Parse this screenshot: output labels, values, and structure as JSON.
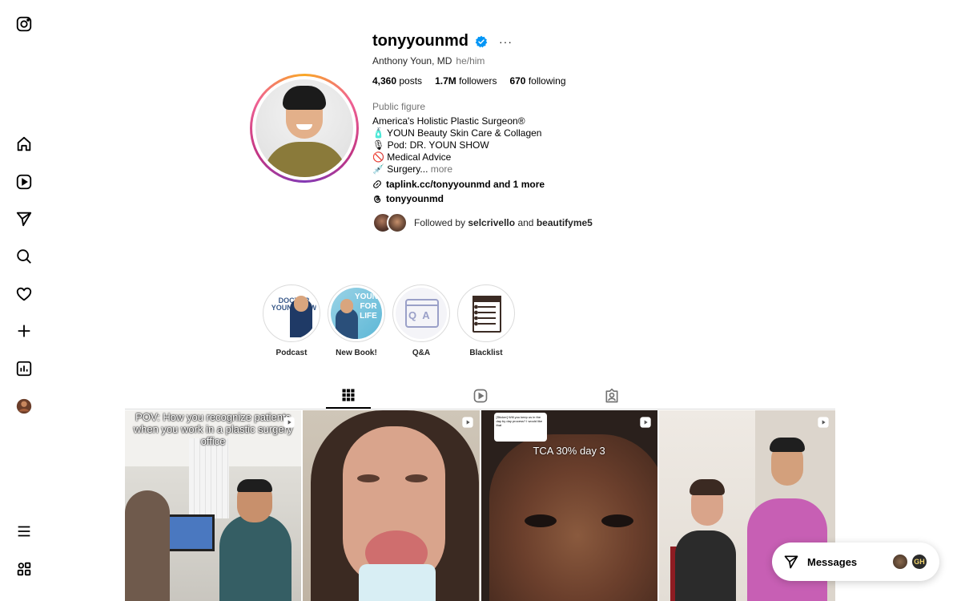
{
  "profile": {
    "username": "tonyyounmd",
    "more_glyph": "···",
    "full_name": "Anthony Youn, MD",
    "pronouns": "he/him",
    "stats": {
      "posts_count": "4,360",
      "posts_label": "posts",
      "followers_count": "1.7M",
      "followers_label": "followers",
      "following_count": "670",
      "following_label": "following"
    },
    "category": "Public figure",
    "bio": [
      "America's Holistic Plastic Surgeon®",
      "🧴 YOUN Beauty Skin Care & Collagen",
      "🎙 Pod: DR. YOUN SHOW",
      "🚫 Medical Advice",
      "💉 Surgery..."
    ],
    "bio_more": "more",
    "link": "taplink.cc/tonyyounmd and 1 more",
    "threads_handle": "tonyyounmd",
    "followed_by": {
      "prefix": "Followed by",
      "user1": "selcrivello",
      "joiner": "and",
      "user2": "beautifyme5"
    }
  },
  "highlights": [
    {
      "label": "Podcast",
      "cover_text": "DOCTOR YOUN SHOW"
    },
    {
      "label": "New Book!",
      "cover_text": "YOUNGER FOR LIFE"
    },
    {
      "label": "Q&A",
      "cover_text": "Q A"
    },
    {
      "label": "Blacklist"
    }
  ],
  "posts": [
    {
      "caption": "POV: How you recognize patients when you work in a plastic surgery office",
      "type": "reel"
    },
    {
      "caption": "",
      "type": "reel"
    },
    {
      "caption": "TCA 30% day 3",
      "sticker_text": "[Sticker] Will you keep us in the day by day process? I would like that",
      "type": "reel"
    },
    {
      "caption": "",
      "type": "reel"
    }
  ],
  "messages": {
    "label": "Messages",
    "avatar2_initials": "GH"
  },
  "colors": {
    "verified": "#0095f6",
    "secondary_text": "#737373",
    "border": "#dbdbdb"
  }
}
